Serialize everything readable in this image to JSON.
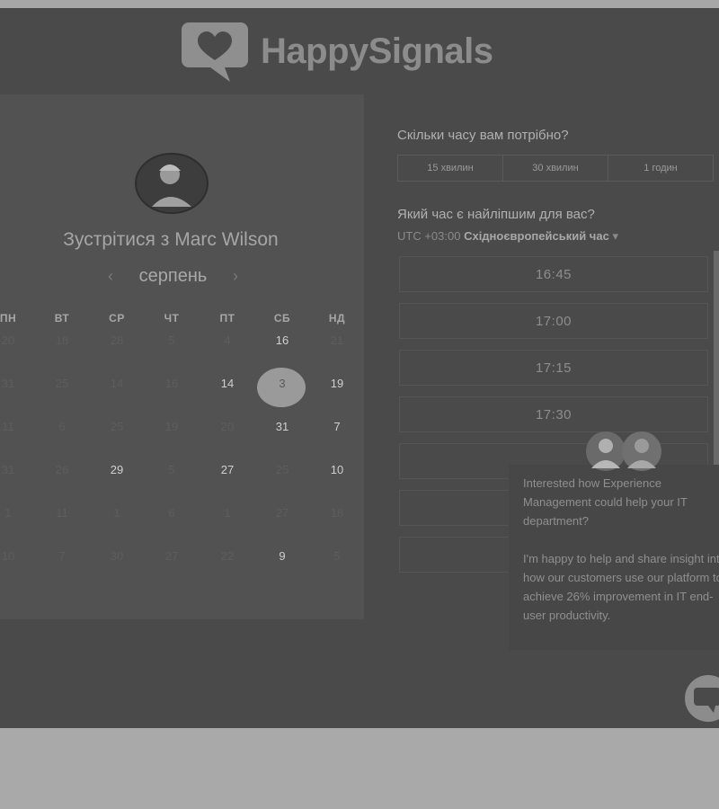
{
  "brand": {
    "name": "HappySignals",
    "logo_icon": "heart-speech-bubble-icon"
  },
  "scheduler": {
    "title": "Зустрітися з Marc Wilson",
    "month": "серпень",
    "weekdays": [
      "ПН",
      "ВТ",
      "СР",
      "ЧТ",
      "ПТ",
      "СБ",
      "НД"
    ],
    "weeks": [
      [
        {
          "d": "20",
          "s": "faint"
        },
        {
          "d": "18",
          "s": "faint"
        },
        {
          "d": "28",
          "s": "faint"
        },
        {
          "d": "5",
          "s": "faint"
        },
        {
          "d": "4",
          "s": "faint"
        },
        {
          "d": "16",
          "s": "active"
        },
        {
          "d": "21",
          "s": "faint"
        }
      ],
      [
        {
          "d": "31",
          "s": "faint"
        },
        {
          "d": "25",
          "s": "faint"
        },
        {
          "d": "14",
          "s": "faint"
        },
        {
          "d": "16",
          "s": "faint"
        },
        {
          "d": "14",
          "s": "active"
        },
        {
          "d": "3",
          "s": "selected"
        },
        {
          "d": "19",
          "s": "active"
        }
      ],
      [
        {
          "d": "11",
          "s": "faint"
        },
        {
          "d": "6",
          "s": "faint"
        },
        {
          "d": "25",
          "s": "faint"
        },
        {
          "d": "19",
          "s": "faint"
        },
        {
          "d": "20",
          "s": "faint"
        },
        {
          "d": "31",
          "s": "active"
        },
        {
          "d": "7",
          "s": "active"
        }
      ],
      [
        {
          "d": "31",
          "s": "faint"
        },
        {
          "d": "26",
          "s": "faint"
        },
        {
          "d": "29",
          "s": "active"
        },
        {
          "d": "5",
          "s": "faint"
        },
        {
          "d": "27",
          "s": "active"
        },
        {
          "d": "25",
          "s": "faint"
        },
        {
          "d": "10",
          "s": "active"
        }
      ],
      [
        {
          "d": "1",
          "s": "faint"
        },
        {
          "d": "11",
          "s": "faint"
        },
        {
          "d": "1",
          "s": "faint"
        },
        {
          "d": "6",
          "s": "faint"
        },
        {
          "d": "1",
          "s": "faint"
        },
        {
          "d": "27",
          "s": "faint"
        },
        {
          "d": "18",
          "s": "faint"
        }
      ],
      [
        {
          "d": "10",
          "s": "faint"
        },
        {
          "d": "7",
          "s": "faint"
        },
        {
          "d": "30",
          "s": "faint"
        },
        {
          "d": "27",
          "s": "faint"
        },
        {
          "d": "22",
          "s": "faint"
        },
        {
          "d": "9",
          "s": "active"
        },
        {
          "d": "5",
          "s": "faint"
        }
      ]
    ],
    "selected_day": "3"
  },
  "right": {
    "duration_question": "Скільки часу вам потрібно?",
    "durations": [
      "15 хвилин",
      "30 хвилин",
      "1 годин"
    ],
    "time_question": "Який час є найліпшим для вас?",
    "timezone_offset": "UTC +03:00",
    "timezone_name": "Східноєвропейський час",
    "slots": [
      "16:45",
      "17:00",
      "17:15",
      "17:30",
      "",
      "",
      ""
    ]
  },
  "chat": {
    "message_1": "Interested how Experience Management could help your IT department?",
    "message_2": "I'm happy to help and share insight into how our customers use our platform to achieve 26% improvement in IT end-user productivity."
  },
  "colors": {
    "overlay": "#4a4a4a",
    "panel": "#525252",
    "selected": "#9a9a9a"
  }
}
